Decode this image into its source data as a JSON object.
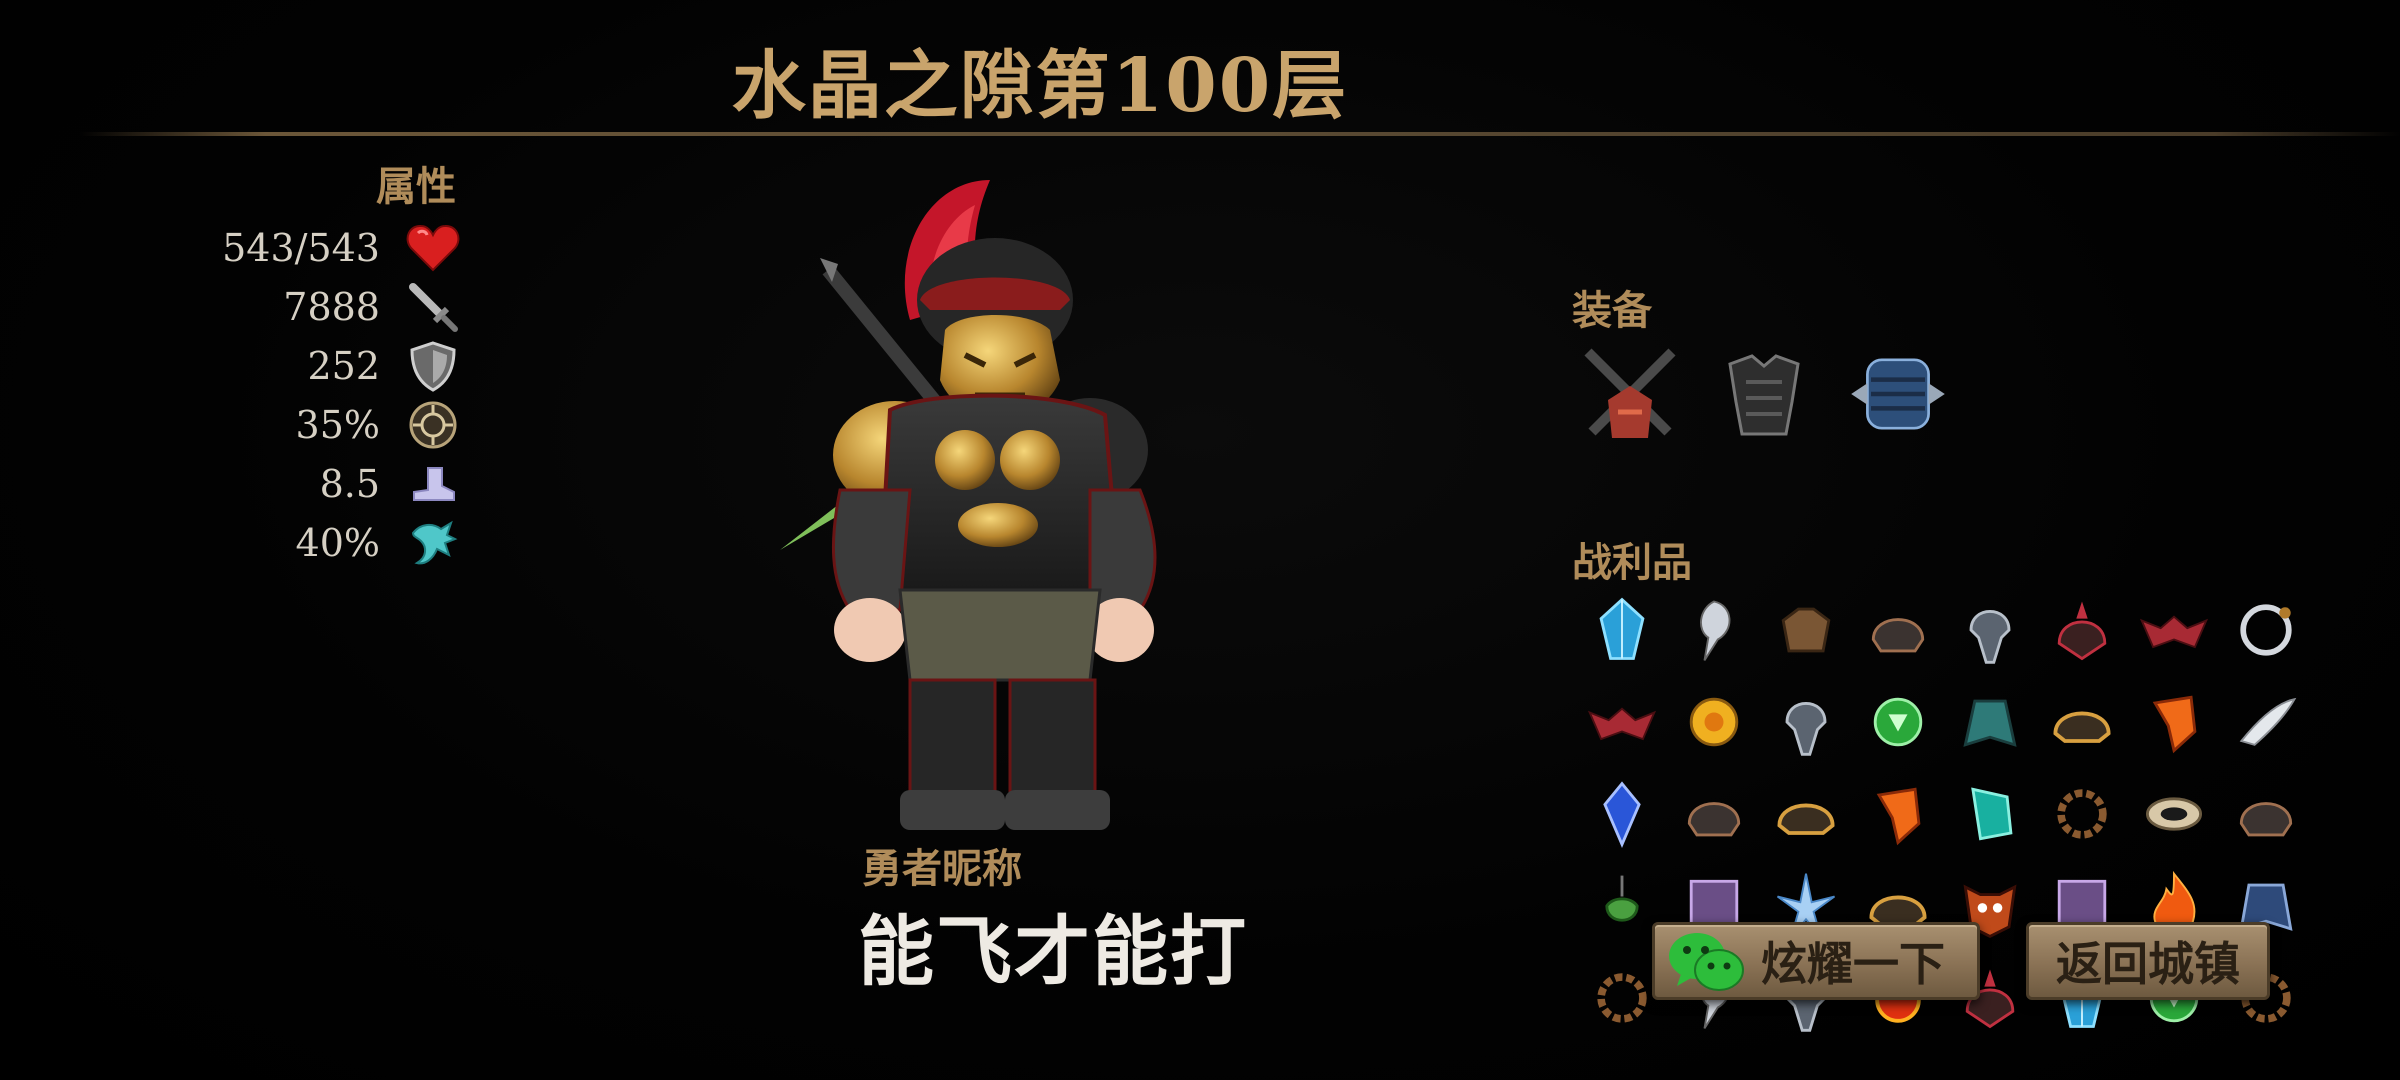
{
  "header": {
    "title": "水晶之隙第100层"
  },
  "stats": {
    "label": "属性",
    "rows": [
      {
        "value": "543/543",
        "icon": "heart-icon",
        "color": "#d91f1f"
      },
      {
        "value": "7888",
        "icon": "sword-icon",
        "color": "#a9a9a9"
      },
      {
        "value": "252",
        "icon": "shield-icon",
        "color": "#9a9a9a"
      },
      {
        "value": "35%",
        "icon": "crit-icon",
        "color": "#8a7a5a"
      },
      {
        "value": "8.5",
        "icon": "boot-icon",
        "color": "#b9b6e0"
      },
      {
        "value": "40%",
        "icon": "dodge-icon",
        "color": "#4fc7c9"
      }
    ]
  },
  "hero": {
    "nickname_label": "勇者昵称",
    "nickname": "能飞才能打"
  },
  "equipment": {
    "label": "装备",
    "items": [
      "crossed-swords-icon",
      "dark-armor-icon",
      "blue-bracer-icon"
    ]
  },
  "loot": {
    "label": "战利品",
    "items": [
      "blue-crystal-icon",
      "silver-earring-icon",
      "leather-vest-icon",
      "dark-helm-icon",
      "iron-helm-icon",
      "spiked-helm-icon",
      "red-bat-mask-icon",
      "silver-ring-icon",
      "red-bat-mask-icon",
      "gold-coin-icon",
      "iron-helm-icon",
      "green-gem-icon",
      "teal-cape-icon",
      "gold-helm-icon",
      "orange-shard-icon",
      "silver-fang-icon",
      "sapphire-icon",
      "dark-helm-icon",
      "gold-helm-icon",
      "orange-shard-icon",
      "teal-shard-icon",
      "bead-bracelet-icon",
      "bone-ring-icon",
      "dark-helm-icon",
      "green-amulet-icon",
      "purple-scroll-icon",
      "ice-crystal-icon",
      "gold-helm-icon",
      "demon-mask-icon",
      "purple-scroll-icon",
      "fire-icon",
      "blue-cape-icon",
      "bead-bracelet-icon",
      "silver-earring-icon",
      "iron-helm-icon",
      "fire-orb-icon",
      "spiked-helm-icon",
      "blue-crystal-icon",
      "green-gem-icon",
      "bead-bracelet-icon"
    ]
  },
  "buttons": {
    "share_label": "炫耀一下",
    "return_label": "返回城镇"
  }
}
